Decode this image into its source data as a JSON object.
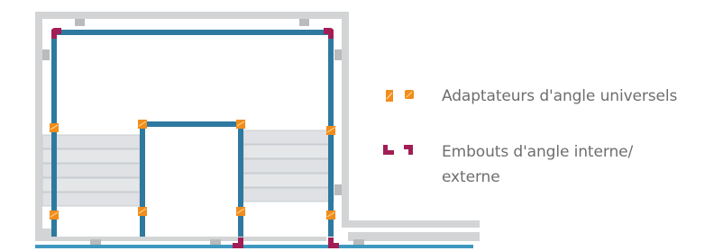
{
  "diagram": {
    "description_elements": [
      "wall-frame",
      "blue-profile",
      "orange-adapter",
      "purple-corner-end",
      "roller-shutter-slats"
    ]
  },
  "legend": {
    "items": [
      {
        "label": "Adaptateurs d'angle universels",
        "icon": "orange-corner-adapter-icon",
        "color": "#f28c1b"
      },
      {
        "label": "Embouts d'angle interne/ externe",
        "icon": "purple-corner-end-icon",
        "color": "#a21d55"
      }
    ]
  },
  "colors": {
    "wall": "#cfd0d1",
    "wall_dark": "#bfc1c3",
    "profile": "#2e79a0",
    "adapter": "#f28c1b",
    "corner_end": "#a21d55",
    "slat": "#dfe2e5"
  }
}
